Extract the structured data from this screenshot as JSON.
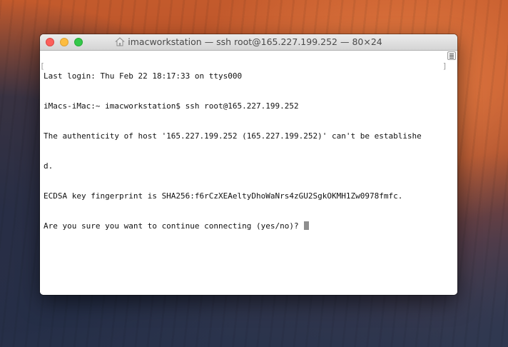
{
  "window": {
    "title": "imacworkstation — ssh root@165.227.199.252 — 80×24"
  },
  "terminal": {
    "lines": [
      "Last login: Thu Feb 22 18:17:33 on ttys000",
      "iMacs-iMac:~ imacworkstation$ ssh root@165.227.199.252",
      "The authenticity of host '165.227.199.252 (165.227.199.252)' can't be establishe",
      "d.",
      "ECDSA key fingerprint is SHA256:f6rCzXEAeltyDhoWaNrs4zGU2SgkOKMH1Zw0978fmfc."
    ],
    "prompt_line": "Are you sure you want to continue connecting (yes/no)? "
  },
  "icons": {
    "title_icon": "home-icon",
    "scroll_marker": "marks-indicator-icon"
  },
  "colors": {
    "close": "#fc605c",
    "minimize": "#fdbc40",
    "zoom": "#34c84a",
    "cursor": "#8e8e8e"
  }
}
